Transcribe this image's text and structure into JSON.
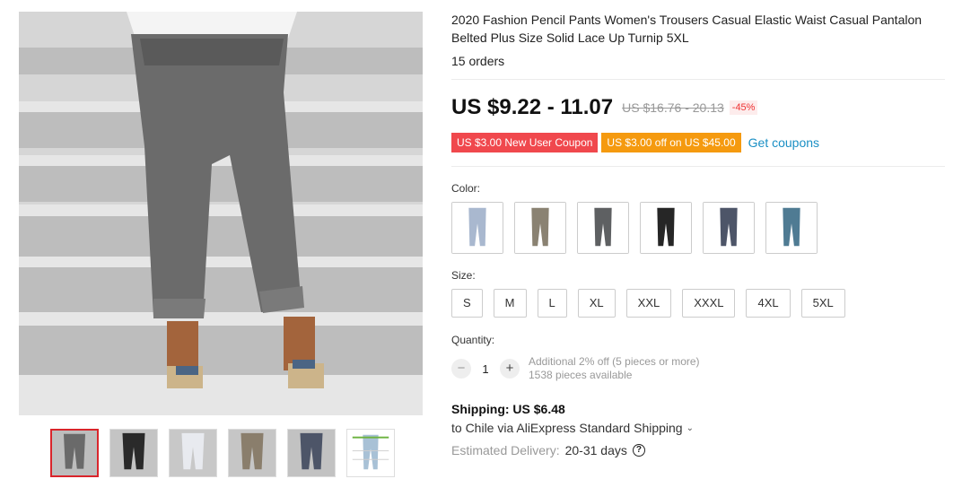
{
  "product": {
    "title": "2020 Fashion Pencil Pants Women's Trousers Casual Elastic Waist Casual Pantalon Belted Plus Size Solid Lace Up Turnip 5XL",
    "orders": "15 orders"
  },
  "price": {
    "current": "US $9.22 - 11.07",
    "original": "US $16.76 - 20.13",
    "discount": "-45%"
  },
  "coupons": {
    "new_user": "US $3.00 New User Coupon",
    "store": "US $3.00 off on US $45.00",
    "get_link": "Get coupons"
  },
  "color": {
    "label": "Color:",
    "swatches": [
      {
        "name": "light-blue",
        "hex": "#a9b8cf"
      },
      {
        "name": "khaki",
        "hex": "#8a8272"
      },
      {
        "name": "gray",
        "hex": "#5e6062"
      },
      {
        "name": "black",
        "hex": "#262626"
      },
      {
        "name": "navy",
        "hex": "#4d5568"
      },
      {
        "name": "teal-blue",
        "hex": "#4f7b93"
      }
    ]
  },
  "size": {
    "label": "Size:",
    "options": [
      "S",
      "M",
      "L",
      "XL",
      "XXL",
      "XXXL",
      "4XL",
      "5XL"
    ]
  },
  "quantity": {
    "label": "Quantity:",
    "value": "1",
    "minus": "−",
    "plus": "+",
    "discount_note": "Additional 2% off (5 pieces or more)",
    "available": "1538 pieces available"
  },
  "shipping": {
    "title": "Shipping: US $6.48",
    "destination": "to Chile via AliExpress Standard Shipping",
    "chevron": "⌄",
    "eta_label": "Estimated Delivery:",
    "eta_days": "20-31 days",
    "help": "?"
  },
  "colors": {
    "accent_red": "#d9252b",
    "coupon_red": "#f0484d",
    "coupon_orange": "#f59a0f",
    "link_blue": "#1a8fc4"
  }
}
